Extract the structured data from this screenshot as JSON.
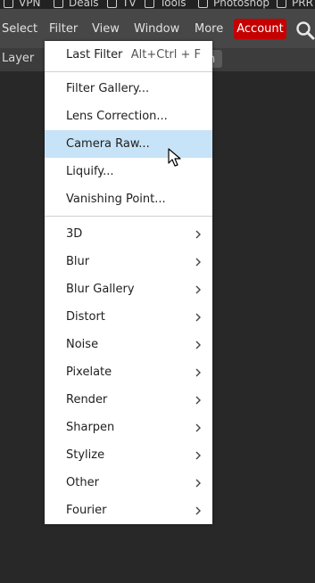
{
  "bookmarks": [
    "VPN",
    "Deals",
    "TV",
    "Tools",
    "Photoshop",
    "PRR"
  ],
  "menubar": {
    "items": [
      "Select",
      "Filter",
      "View",
      "Window",
      "More"
    ],
    "account": "Account"
  },
  "optionbar": {
    "layer_label": "Layer",
    "partial": "n"
  },
  "filter_menu": {
    "last_filter": {
      "label": "Last Filter",
      "shortcut": "Alt+Ctrl + F"
    },
    "group1": [
      "Filter Gallery...",
      "Lens Correction...",
      "Camera Raw...",
      "Liquify...",
      "Vanishing Point..."
    ],
    "highlighted": "Camera Raw...",
    "submenus": [
      "3D",
      "Blur",
      "Blur Gallery",
      "Distort",
      "Noise",
      "Pixelate",
      "Render",
      "Sharpen",
      "Stylize",
      "Other",
      "Fourier"
    ]
  },
  "colors": {
    "accent": "#c40000",
    "highlight": "#c7e3f7",
    "menubar": "#474747",
    "canvas": "#282828"
  }
}
